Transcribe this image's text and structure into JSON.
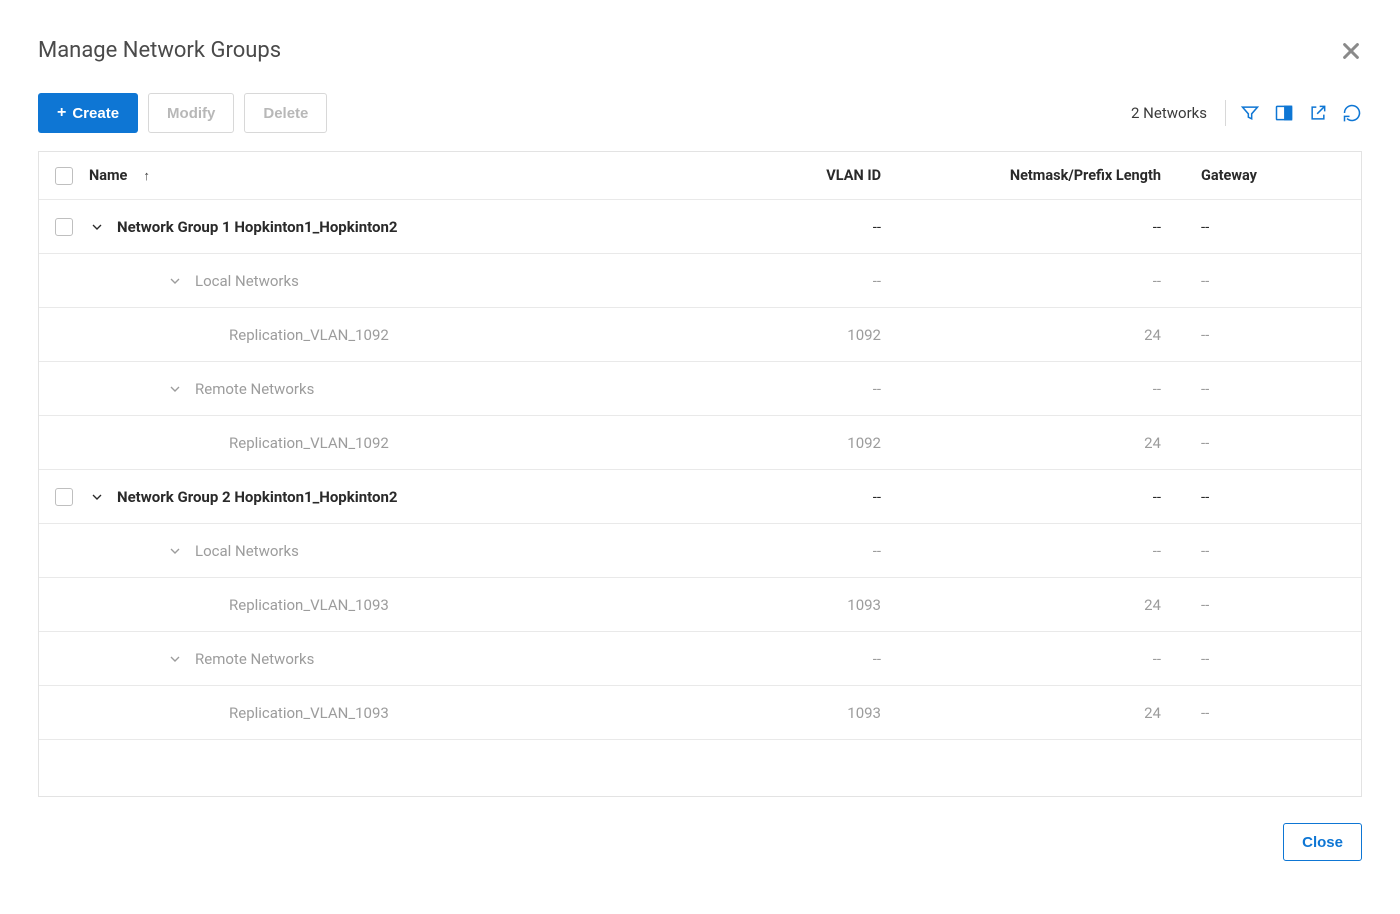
{
  "title": "Manage Network Groups",
  "buttons": {
    "create": "Create",
    "modify": "Modify",
    "delete": "Delete",
    "close": "Close"
  },
  "summary": "2 Networks",
  "columns": {
    "name": "Name",
    "vlan": "VLAN ID",
    "netmask": "Netmask/Prefix Length",
    "gateway": "Gateway"
  },
  "groups": [
    {
      "name": "Network Group 1 Hopkinton1_Hopkinton2",
      "vlan": "--",
      "netmask": "--",
      "gateway": "--",
      "sections": [
        {
          "label": "Local Networks",
          "vlan": "--",
          "netmask": "--",
          "gateway": "--",
          "items": [
            {
              "name": "Replication_VLAN_1092",
              "vlan": "1092",
              "netmask": "24",
              "gateway": "--"
            }
          ]
        },
        {
          "label": "Remote Networks",
          "vlan": "--",
          "netmask": "--",
          "gateway": "--",
          "items": [
            {
              "name": "Replication_VLAN_1092",
              "vlan": "1092",
              "netmask": "24",
              "gateway": "--"
            }
          ]
        }
      ]
    },
    {
      "name": "Network Group 2 Hopkinton1_Hopkinton2",
      "vlan": "--",
      "netmask": "--",
      "gateway": "--",
      "sections": [
        {
          "label": "Local Networks",
          "vlan": "--",
          "netmask": "--",
          "gateway": "--",
          "items": [
            {
              "name": "Replication_VLAN_1093",
              "vlan": "1093",
              "netmask": "24",
              "gateway": "--"
            }
          ]
        },
        {
          "label": "Remote Networks",
          "vlan": "--",
          "netmask": "--",
          "gateway": "--",
          "items": [
            {
              "name": "Replication_VLAN_1093",
              "vlan": "1093",
              "netmask": "24",
              "gateway": "--"
            }
          ]
        }
      ]
    }
  ]
}
